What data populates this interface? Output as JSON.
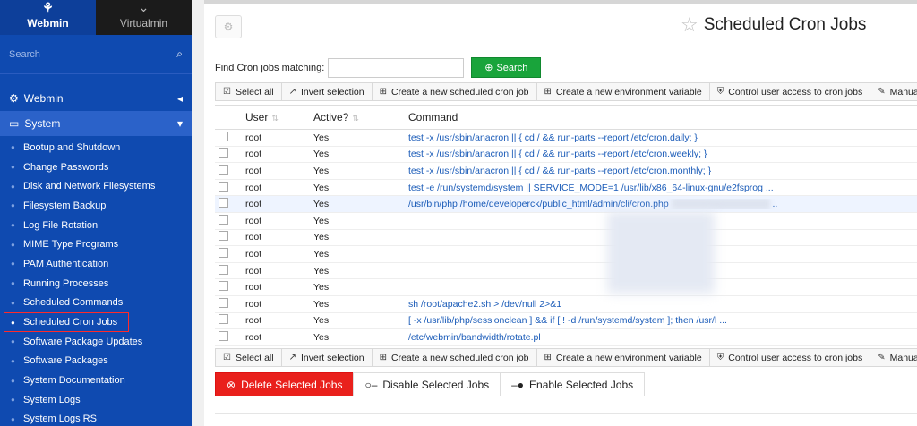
{
  "sidebar": {
    "switch": {
      "webmin": "Webmin",
      "virtualmin": "Virtualmin"
    },
    "search_placeholder": "Search",
    "categories": {
      "webmin": "Webmin",
      "system": "System"
    },
    "items": [
      "Bootup and Shutdown",
      "Change Passwords",
      "Disk and Network Filesystems",
      "Filesystem Backup",
      "Log File Rotation",
      "MIME Type Programs",
      "PAM Authentication",
      "Running Processes",
      "Scheduled Commands",
      "Scheduled Cron Jobs",
      "Software Package Updates",
      "Software Packages",
      "System Documentation",
      "System Logs",
      "System Logs RS"
    ]
  },
  "page": {
    "title": "Scheduled Cron Jobs"
  },
  "find": {
    "label": "Find Cron jobs matching:",
    "value": "",
    "button": "Search"
  },
  "toolbar": {
    "select_all": "Select all",
    "invert": "Invert selection",
    "create_job": "Create a new scheduled cron job",
    "create_env": "Create a new environment variable",
    "control_access": "Control user access to cron jobs",
    "manually_edit": "Manually ed"
  },
  "table": {
    "headers": {
      "user": "User",
      "active": "Active?",
      "command": "Command"
    },
    "rows": [
      {
        "user": "root",
        "active": "Yes",
        "command": "test -x /usr/sbin/anacron || { cd / && run-parts --report /etc/cron.daily; }"
      },
      {
        "user": "root",
        "active": "Yes",
        "command": "test -x /usr/sbin/anacron || { cd / && run-parts --report /etc/cron.weekly; }"
      },
      {
        "user": "root",
        "active": "Yes",
        "command": "test -x /usr/sbin/anacron || { cd / && run-parts --report /etc/cron.monthly; }"
      },
      {
        "user": "root",
        "active": "Yes",
        "command": "test -e /run/systemd/system || SERVICE_MODE=1 /usr/lib/x86_64-linux-gnu/e2fsprog ..."
      },
      {
        "user": "root",
        "active": "Yes",
        "command": "/usr/bin/php /home/developerck/public_html/admin/cli/cron.php",
        "suffix": ".."
      },
      {
        "user": "root",
        "active": "Yes",
        "command": ""
      },
      {
        "user": "root",
        "active": "Yes",
        "command": ""
      },
      {
        "user": "root",
        "active": "Yes",
        "command": ""
      },
      {
        "user": "root",
        "active": "Yes",
        "command": ""
      },
      {
        "user": "root",
        "active": "Yes",
        "command": ""
      },
      {
        "user": "root",
        "active": "Yes",
        "command": "sh /root/apache2.sh > /dev/null 2>&1"
      },
      {
        "user": "root",
        "active": "Yes",
        "command": "[ -x /usr/lib/php/sessionclean ] && if [ ! -d /run/systemd/system ]; then /usr/l ..."
      },
      {
        "user": "root",
        "active": "Yes",
        "command": "/etc/webmin/bandwidth/rotate.pl"
      }
    ]
  },
  "actions": {
    "delete": "Delete Selected Jobs",
    "disable": "Disable Selected Jobs",
    "enable": "Enable Selected Jobs"
  },
  "colors": {
    "sidebar": "#0f4ab0",
    "sidebar_active": "#2b62c9",
    "search_green": "#19a43b",
    "danger": "#e9201c",
    "link": "#1a5bb8"
  }
}
